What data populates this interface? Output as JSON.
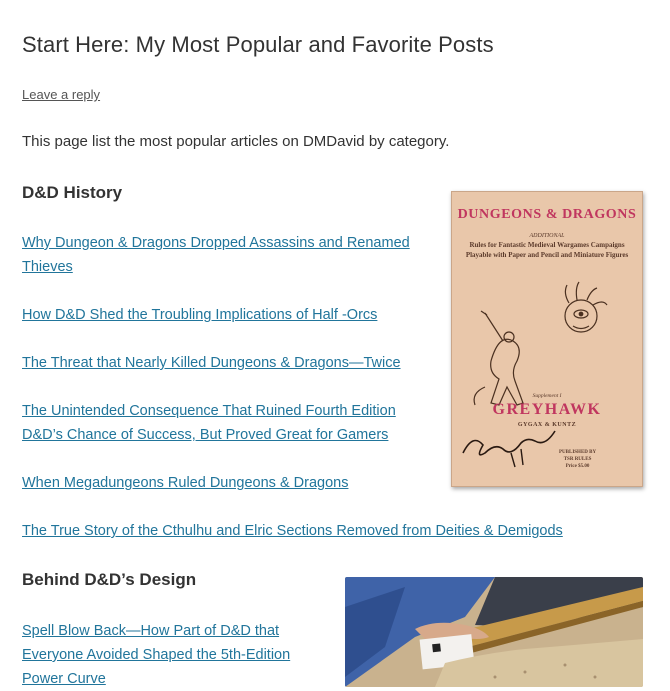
{
  "page": {
    "title": "Start Here: My Most Popular and Favorite Posts",
    "reply_link": "Leave a reply",
    "intro": "This page list the most popular articles on DMDavid by category."
  },
  "sections": [
    {
      "heading": "D&D History",
      "posts": [
        "Why Dungeon & Dragons Dropped Assassins and Renamed Thieves",
        "How D&D Shed the Troubling Implications of Half -Orcs",
        "The Threat that Nearly Killed Dungeons & Dragons—Twice",
        "The Unintended Consequence That Ruined Fourth Edition D&D’s Chance of Success, But Proved Great for Gamers",
        "When Megadungeons Ruled Dungeons & Dragons",
        "The True Story of the Cthulhu and Elric Sections Removed from Deities & Demigods"
      ]
    },
    {
      "heading": "Behind D&D’s Design",
      "posts": [
        "Spell Blow Back—How Part of D&D that Everyone Avoided Shaped the 5th-Edition Power Curve"
      ]
    }
  ],
  "cover": {
    "title": "DUNGEONS & DRAGONS",
    "additional": "ADDITIONAL",
    "subtitle": "Rules for Fantastic Medieval Wargames Campaigns Playable with Paper and Pencil and Miniature Figures",
    "supplement": "Supplement I",
    "name": "GREYHAWK",
    "authors": "GYGAX & KUNTZ",
    "publisher_line1": "PUBLISHED BY",
    "publisher_line2": "TSR RULES",
    "price": "Price $5.00"
  },
  "colors": {
    "link": "#21759b",
    "text": "#333333",
    "cover_bg": "#e9c7aa",
    "cover_accent": "#c0365f"
  }
}
